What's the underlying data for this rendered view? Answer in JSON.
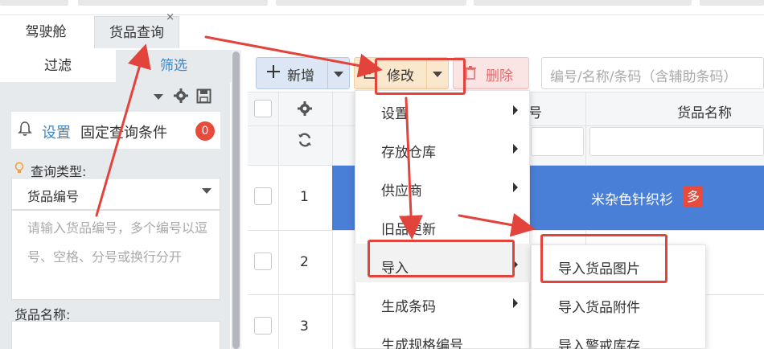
{
  "tabs": {
    "cockpit": "驾驶舱",
    "goods_query": "货品查询",
    "close": "×"
  },
  "left_panel": {
    "tab_filter": "过滤",
    "tab_select": "筛选",
    "condition": {
      "set_link": "设置",
      "fixed_label": "固定查询条件",
      "count": "0"
    },
    "query_type_label": "查询类型:",
    "query_type_value": "货品编号",
    "goods_no_placeholder": "请输入货品编号，多个编号以逗号、空格、分号或换行分开",
    "goods_name_label": "货品名称:"
  },
  "toolbar": {
    "add_label": "新增",
    "edit_label": "修改",
    "delete_label": "删除",
    "search_placeholder": "编号/名称/条码（含辅助条码）"
  },
  "grid": {
    "column_goods_name": "货品名称",
    "column_number_partial": "号",
    "rows": [
      {
        "index": "1",
        "goods_name": "米杂色针织衫",
        "badge": "多"
      },
      {
        "index": "2"
      },
      {
        "index": "3"
      }
    ]
  },
  "edit_menu": {
    "items": [
      "设置",
      "存放仓库",
      "供应商",
      "旧品更新",
      "导入",
      "生成条码",
      "生成规格编号"
    ],
    "import_submenu": [
      "导入货品图片",
      "导入货品附件",
      "导入警戒库存"
    ]
  },
  "icons": {
    "add": "plus-icon",
    "edit": "edit-icon",
    "delete": "trash-icon",
    "bell": "bell-icon",
    "gear": "gear-icon",
    "save": "save-icon",
    "refresh": "refresh-icon",
    "bulb": "bulb-icon"
  },
  "colors": {
    "accent": "#3d86c9",
    "selected_row": "#4a7fd8",
    "annotation": "#e2433b",
    "badge": "#e84a3c"
  }
}
